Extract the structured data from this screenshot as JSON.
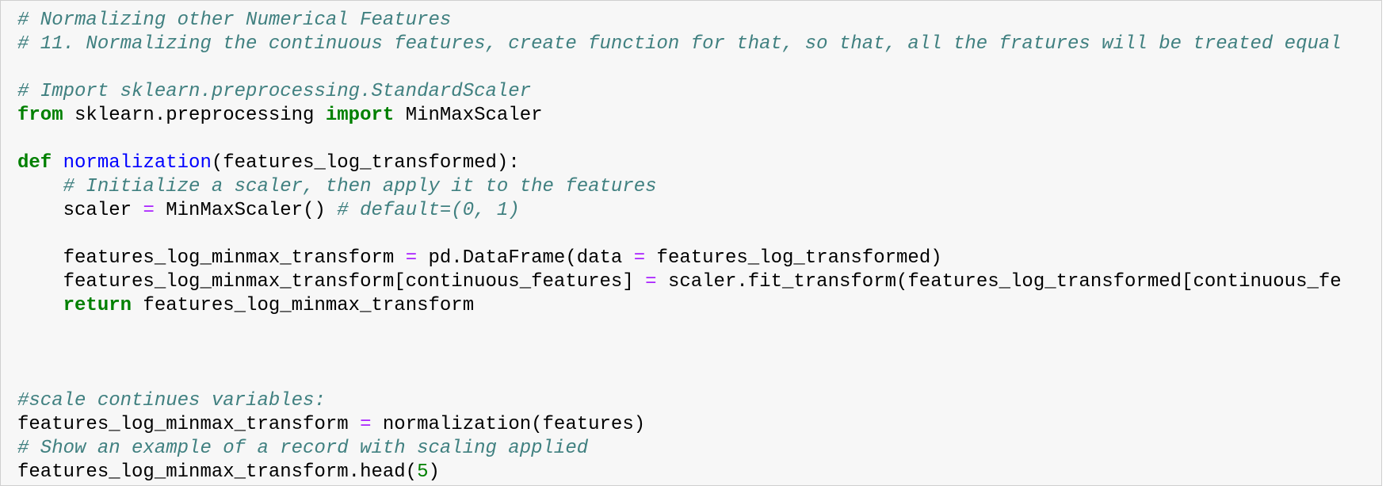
{
  "code_cell": {
    "lines": [
      {
        "tokens": [
          {
            "t": "# Normalizing other Numerical Features",
            "c": "comment"
          }
        ]
      },
      {
        "tokens": [
          {
            "t": "# 11. Normalizing the continuous features, create function for that, so that, all the fratures will be treated equal",
            "c": "comment"
          }
        ]
      },
      {
        "tokens": []
      },
      {
        "tokens": [
          {
            "t": "# Import sklearn.preprocessing.StandardScaler",
            "c": "comment"
          }
        ]
      },
      {
        "tokens": [
          {
            "t": "from",
            "c": "keyword"
          },
          {
            "t": " sklearn.preprocessing ",
            "c": "plain"
          },
          {
            "t": "import",
            "c": "keyword"
          },
          {
            "t": " MinMaxScaler",
            "c": "plain"
          }
        ]
      },
      {
        "tokens": []
      },
      {
        "tokens": [
          {
            "t": "def",
            "c": "keyword"
          },
          {
            "t": " ",
            "c": "plain"
          },
          {
            "t": "normalization",
            "c": "function"
          },
          {
            "t": "(features_log_transformed):",
            "c": "plain"
          }
        ]
      },
      {
        "tokens": [
          {
            "t": "    ",
            "c": "plain"
          },
          {
            "t": "# Initialize a scaler, then apply it to the features",
            "c": "comment"
          }
        ]
      },
      {
        "tokens": [
          {
            "t": "    scaler ",
            "c": "plain"
          },
          {
            "t": "=",
            "c": "operator"
          },
          {
            "t": " MinMaxScaler() ",
            "c": "plain"
          },
          {
            "t": "# default=(0, 1)",
            "c": "comment"
          }
        ]
      },
      {
        "tokens": []
      },
      {
        "tokens": [
          {
            "t": "    features_log_minmax_transform ",
            "c": "plain"
          },
          {
            "t": "=",
            "c": "operator"
          },
          {
            "t": " pd.DataFrame(data ",
            "c": "plain"
          },
          {
            "t": "=",
            "c": "operator"
          },
          {
            "t": " features_log_transformed)",
            "c": "plain"
          }
        ]
      },
      {
        "tokens": [
          {
            "t": "    features_log_minmax_transform[continuous_features] ",
            "c": "plain"
          },
          {
            "t": "=",
            "c": "operator"
          },
          {
            "t": " scaler.fit_transform(features_log_transformed[continuous_fe",
            "c": "plain"
          }
        ]
      },
      {
        "tokens": [
          {
            "t": "    ",
            "c": "plain"
          },
          {
            "t": "return",
            "c": "keyword"
          },
          {
            "t": " features_log_minmax_transform",
            "c": "plain"
          }
        ]
      },
      {
        "tokens": []
      },
      {
        "tokens": []
      },
      {
        "tokens": []
      },
      {
        "tokens": [
          {
            "t": "#scale continues variables:",
            "c": "comment"
          }
        ]
      },
      {
        "tokens": [
          {
            "t": "features_log_minmax_transform ",
            "c": "plain"
          },
          {
            "t": "=",
            "c": "operator"
          },
          {
            "t": " normalization(features)",
            "c": "plain"
          }
        ]
      },
      {
        "tokens": [
          {
            "t": "# Show an example of a record with scaling applied",
            "c": "comment"
          }
        ]
      },
      {
        "tokens": [
          {
            "t": "features_log_minmax_transform.head(",
            "c": "plain"
          },
          {
            "t": "5",
            "c": "number"
          },
          {
            "t": ")",
            "c": "plain"
          }
        ]
      }
    ]
  },
  "colors": {
    "cell_background": "#f7f7f7",
    "cell_border": "#cfcfcf",
    "comment": "#408080",
    "keyword": "#008000",
    "function": "#0000ff",
    "operator": "#aa22ff",
    "number": "#008000",
    "plain": "#000000"
  }
}
